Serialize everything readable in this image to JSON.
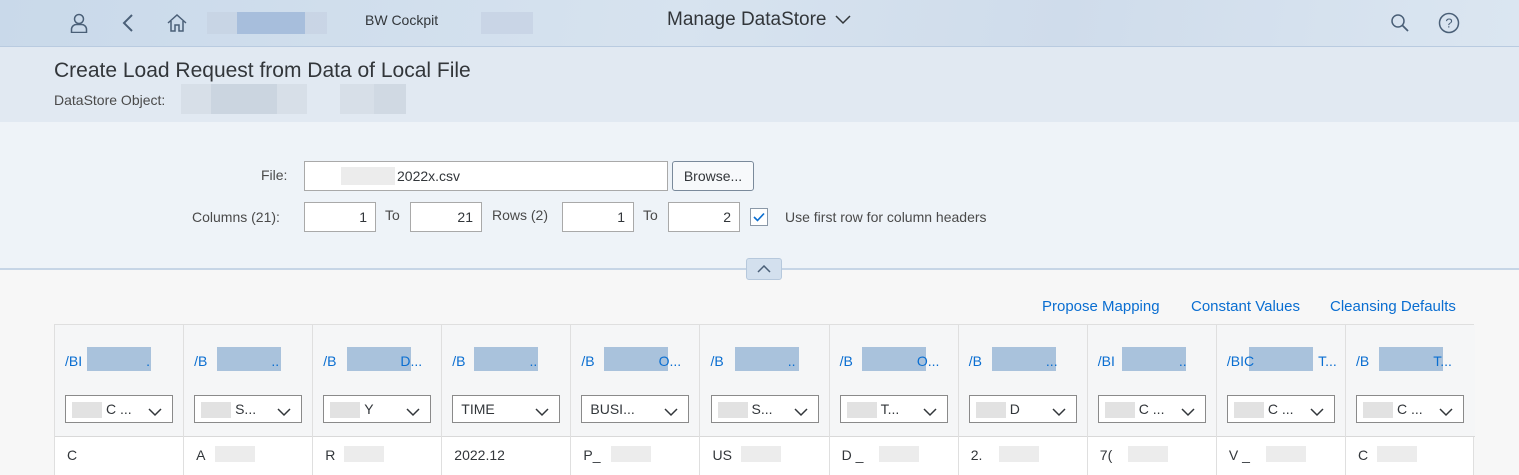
{
  "shell": {
    "app_name": "BW Cockpit",
    "page_title": "Manage DataStore",
    "icons": [
      "user-icon",
      "back-icon",
      "home-icon",
      "search-icon",
      "help-icon"
    ]
  },
  "header": {
    "title": "Create Load Request from Data of Local File",
    "object_label": "DataStore Object:"
  },
  "form": {
    "file_label": "File:",
    "file_value": "2022x.csv",
    "browse_label": "Browse...",
    "columns_label": "Columns (21):",
    "columns_from": "1",
    "to_label": "To",
    "columns_to": "21",
    "rows_label": "Rows (2)",
    "rows_from": "1",
    "rows_to": "2",
    "use_first_row_checked": true,
    "use_first_row_label": "Use first row for column headers"
  },
  "actions": {
    "propose_mapping": "Propose Mapping",
    "constant_values": "Constant Values",
    "cleansing_defaults": "Cleansing Defaults"
  },
  "table": {
    "columns": [
      {
        "name": "/BI",
        "name_end": ".",
        "mapping": "C ...",
        "cell": "C"
      },
      {
        "name": "/B",
        "name_end": "..",
        "mapping": "S...",
        "cell": "A"
      },
      {
        "name": "/B",
        "name_end": "D...",
        "mapping": "Y",
        "cell": "R"
      },
      {
        "name": "/B",
        "name_end": "..",
        "mapping": "TIME",
        "cell": "2022.12"
      },
      {
        "name": "/B",
        "name_end": "O...",
        "mapping": "BUSI...",
        "cell": "P_"
      },
      {
        "name": "/B",
        "name_end": "..",
        "mapping": "S...",
        "cell": "US"
      },
      {
        "name": "/B",
        "name_end": "O...",
        "mapping": "T...",
        "cell": "D _"
      },
      {
        "name": "/B",
        "name_end": "...",
        "mapping": "D",
        "cell": "2."
      },
      {
        "name": "/BI",
        "name_end": "..",
        "mapping": "C ...",
        "cell": "7("
      },
      {
        "name": "/BIC",
        "name_end": "T...",
        "mapping": "C ...",
        "cell": "V _"
      },
      {
        "name": "/B",
        "name_end": "T...",
        "mapping": "C ...",
        "cell": "C"
      }
    ]
  },
  "colors": {
    "link": "#0a6ed1",
    "shell_bg": "#cfdceb",
    "header_bg": "#e1e9f2",
    "form_bg": "#eef3f8"
  }
}
